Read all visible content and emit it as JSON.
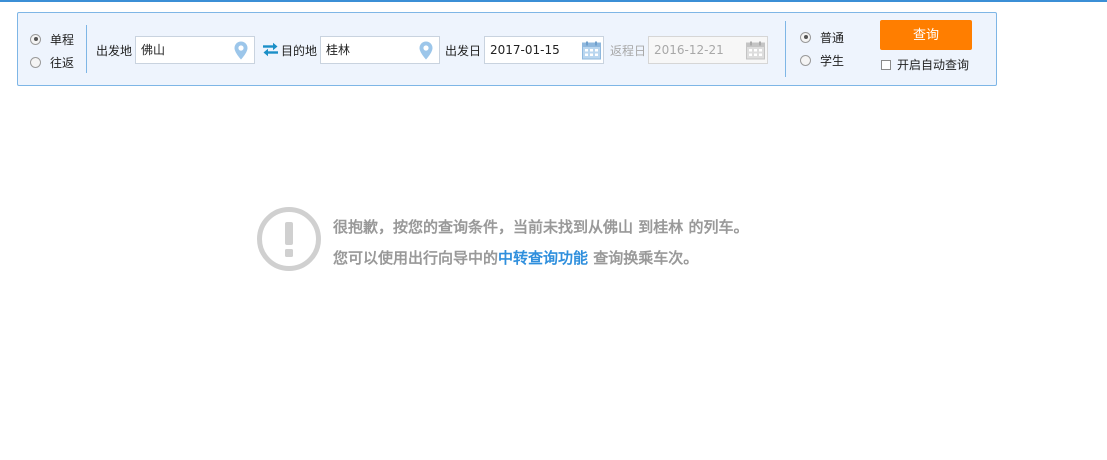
{
  "trip_type": {
    "options": [
      {
        "label": "单程",
        "checked": true
      },
      {
        "label": "往返",
        "checked": false
      }
    ]
  },
  "departure": {
    "label": "出发地",
    "value": "佛山",
    "icon": "location-pin-icon"
  },
  "swap": {
    "icon": "swap-arrows-icon"
  },
  "destination": {
    "label": "目的地",
    "value": "桂林",
    "icon": "location-pin-icon"
  },
  "depart_date": {
    "label": "出发日",
    "value": "2017-01-15",
    "icon": "calendar-icon"
  },
  "return_date": {
    "label": "返程日",
    "value": "2016-12-21",
    "icon": "calendar-icon",
    "disabled": true
  },
  "passenger_type": {
    "options": [
      {
        "label": "普通",
        "checked": true
      },
      {
        "label": "学生",
        "checked": false
      }
    ]
  },
  "query_button": {
    "label": "查询"
  },
  "auto_query": {
    "label": "开启自动查询",
    "checked": false
  },
  "no_result": {
    "icon": "exclamation-circle-icon",
    "text_before": "很抱歉，按您的查询条件，当前未找到从佛山 到桂林 的列车。您可以使用出行向导中的",
    "link_text": "中转查询功能",
    "text_after": " 查询换乘车次。"
  },
  "colors": {
    "accent_blue": "#3b8fd6",
    "query_orange": "#ff7e00",
    "link_blue": "#2f8fdd",
    "message_gray": "#999999",
    "panel_bg": "#eef4fd"
  }
}
